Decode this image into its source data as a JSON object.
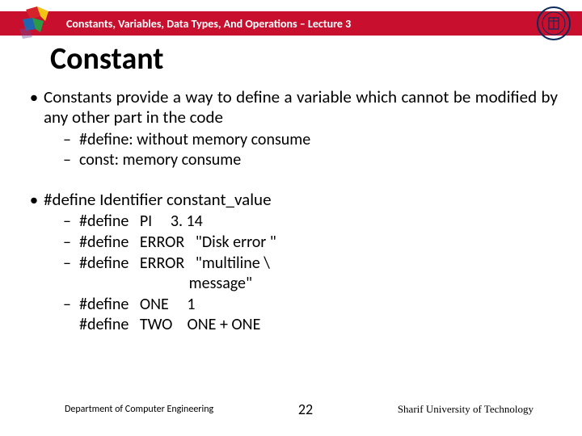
{
  "header": {
    "breadcrumb": "Constants, Variables, Data Types, And Operations – Lecture 3"
  },
  "title": "Constant",
  "bullets": [
    {
      "text": "Constants provide a way to define a variable which cannot be modified by any other part in the code",
      "sub": [
        "#define:  without memory consume",
        "const: memory consume"
      ]
    },
    {
      "text": "#define   Identifier    constant_value",
      "sub": [
        "#define   PI     3. 14",
        "#define   ERROR   \"Disk error \"",
        "#define   ERROR   \"multiline \\",
        "#define   ONE     1"
      ],
      "sub_cont_after_2": "                              message\"",
      "sub_cont_after_3": "#define   TWO    ONE + ONE"
    }
  ],
  "footer": {
    "dept": "Department of Computer Engineering",
    "page": "22",
    "uni": "Sharif University of Technology"
  },
  "icons": {
    "left_logo": "puzzle-logo",
    "right_logo": "university-seal"
  }
}
